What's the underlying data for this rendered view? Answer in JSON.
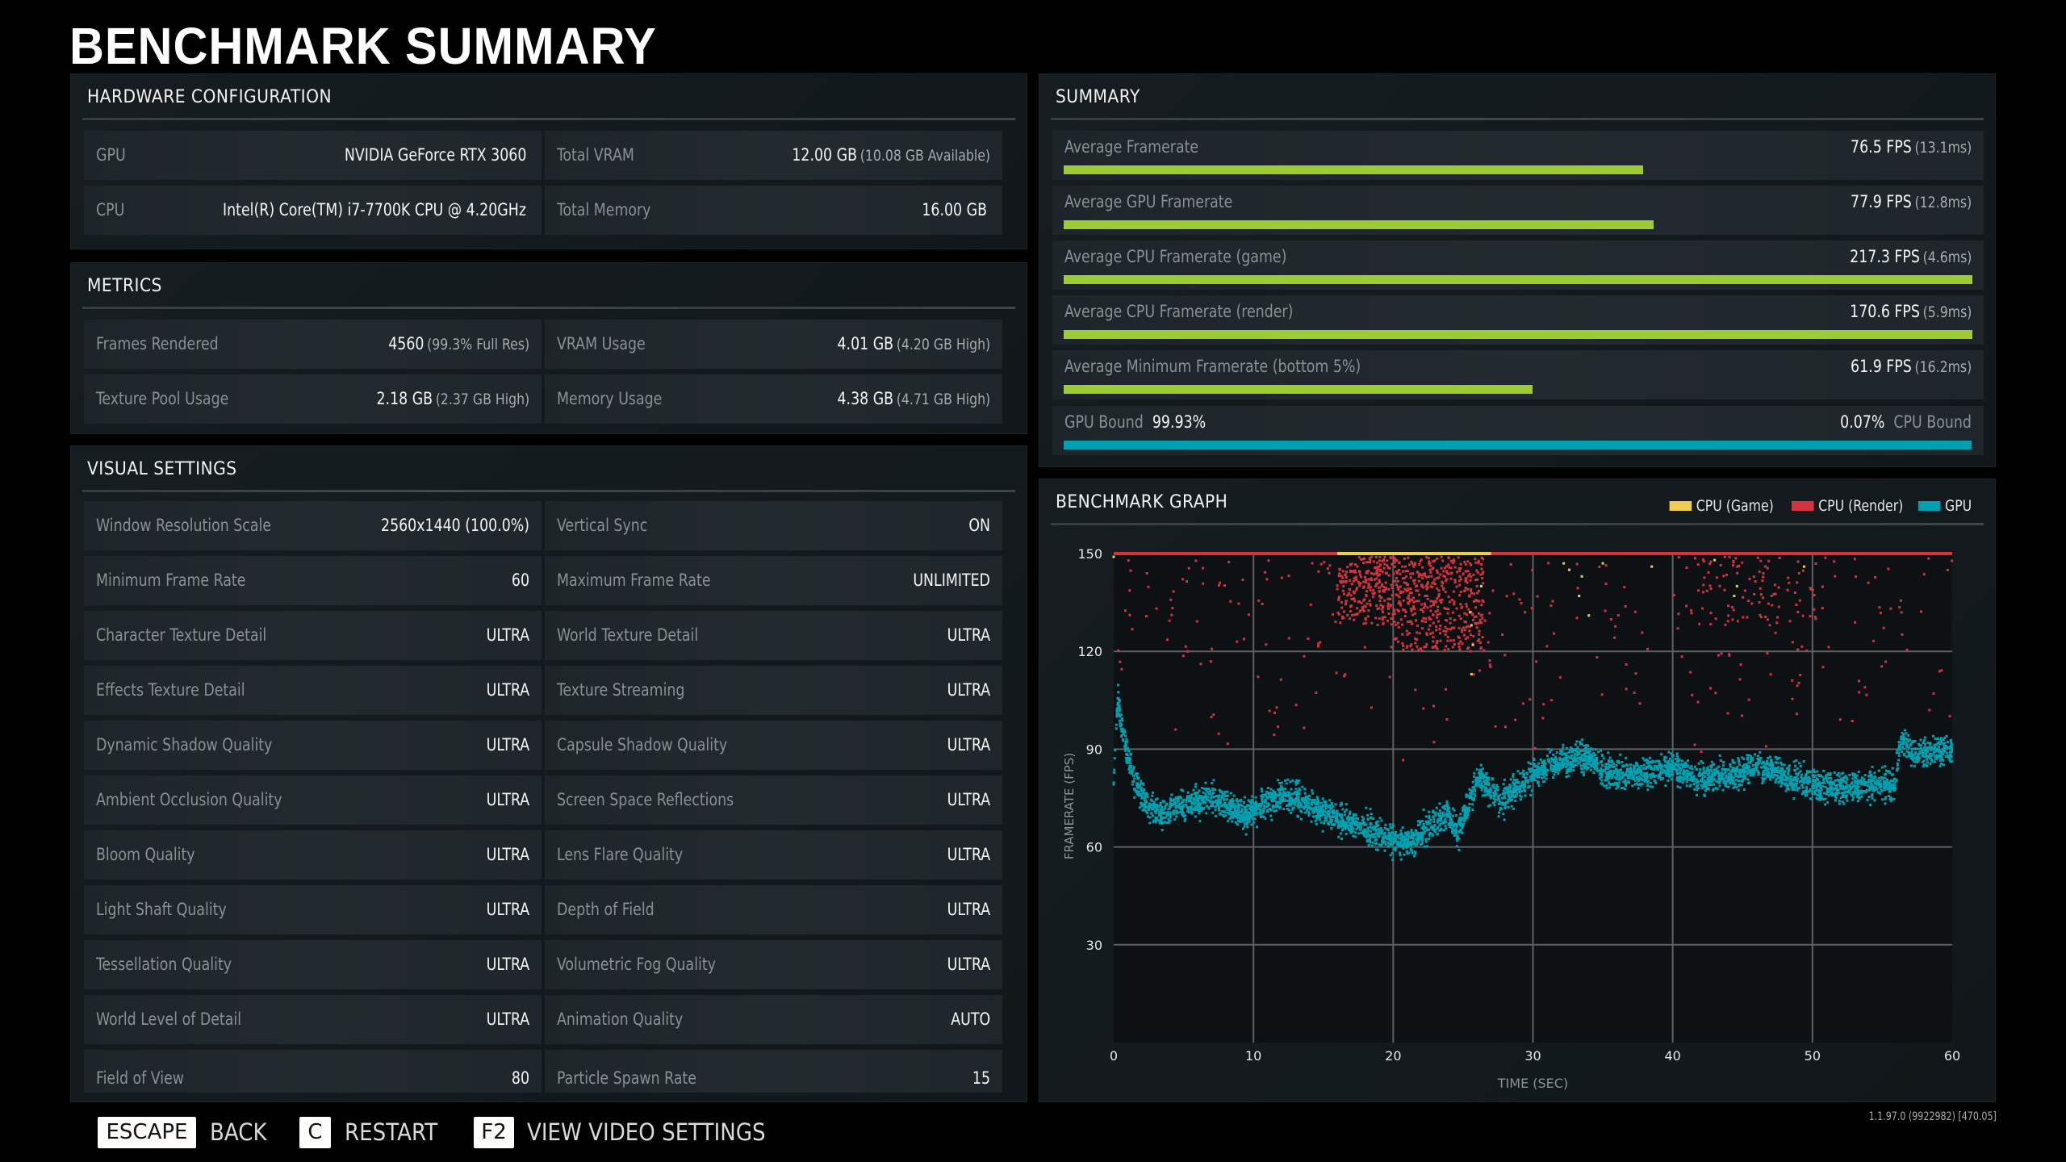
{
  "page_title": "BENCHMARK SUMMARY",
  "hardware": {
    "title": "HARDWARE CONFIGURATION",
    "rows": [
      {
        "label": "GPU",
        "value": "NVIDIA GeForce RTX 3060",
        "sub": ""
      },
      {
        "label": "Total VRAM",
        "value": "12.00 GB",
        "sub": "(10.08 GB Available)"
      },
      {
        "label": "CPU",
        "value": "Intel(R) Core(TM) i7-7700K CPU @ 4.20GHz",
        "sub": ""
      },
      {
        "label": "Total Memory",
        "value": "16.00 GB",
        "sub": ""
      }
    ]
  },
  "metrics": {
    "title": "METRICS",
    "rows": [
      {
        "label": "Frames Rendered",
        "value": "4560",
        "sub": "(99.3% Full Res)"
      },
      {
        "label": "VRAM Usage",
        "value": "4.01 GB",
        "sub": "(4.20 GB High)"
      },
      {
        "label": "Texture Pool Usage",
        "value": "2.18 GB",
        "sub": "(2.37 GB High)"
      },
      {
        "label": "Memory Usage",
        "value": "4.38 GB",
        "sub": "(4.71 GB High)"
      }
    ]
  },
  "visual_settings": {
    "title": "VISUAL SETTINGS",
    "rows": [
      {
        "label": "Window Resolution Scale",
        "value": "2560x1440 (100.0%)"
      },
      {
        "label": "Vertical Sync",
        "value": "ON"
      },
      {
        "label": "Minimum Frame Rate",
        "value": "60"
      },
      {
        "label": "Maximum Frame Rate",
        "value": "UNLIMITED"
      },
      {
        "label": "Character Texture Detail",
        "value": "ULTRA"
      },
      {
        "label": "World Texture Detail",
        "value": "ULTRA"
      },
      {
        "label": "Effects Texture Detail",
        "value": "ULTRA"
      },
      {
        "label": "Texture Streaming",
        "value": "ULTRA"
      },
      {
        "label": "Dynamic Shadow Quality",
        "value": "ULTRA"
      },
      {
        "label": "Capsule Shadow Quality",
        "value": "ULTRA"
      },
      {
        "label": "Ambient Occlusion Quality",
        "value": "ULTRA"
      },
      {
        "label": "Screen Space Reflections",
        "value": "ULTRA"
      },
      {
        "label": "Bloom Quality",
        "value": "ULTRA"
      },
      {
        "label": "Lens Flare Quality",
        "value": "ULTRA"
      },
      {
        "label": "Light Shaft Quality",
        "value": "ULTRA"
      },
      {
        "label": "Depth of Field",
        "value": "ULTRA"
      },
      {
        "label": "Tessellation Quality",
        "value": "ULTRA"
      },
      {
        "label": "Volumetric Fog Quality",
        "value": "ULTRA"
      },
      {
        "label": "World Level of Detail",
        "value": "ULTRA"
      },
      {
        "label": "Animation Quality",
        "value": "AUTO"
      },
      {
        "label": "Field of View",
        "value": "80"
      },
      {
        "label": "Particle Spawn Rate",
        "value": "15"
      }
    ]
  },
  "summary": {
    "title": "SUMMARY",
    "bar_color": "#9ccb34",
    "bound_color": "#00a0b0",
    "rows": [
      {
        "label": "Average Framerate",
        "value": "76.5 FPS",
        "sub": "(13.1ms)",
        "fill": 0.6375
      },
      {
        "label": "Average GPU Framerate",
        "value": "77.9 FPS",
        "sub": "(12.8ms)",
        "fill": 0.649
      },
      {
        "label": "Average CPU Framerate (game)",
        "value": "217.3 FPS",
        "sub": "(4.6ms)",
        "fill": 1.0
      },
      {
        "label": "Average CPU Framerate (render)",
        "value": "170.6 FPS",
        "sub": "(5.9ms)",
        "fill": 1.0
      },
      {
        "label": "Average Minimum Framerate (bottom 5%)",
        "value": "61.9 FPS",
        "sub": "(16.2ms)",
        "fill": 0.516
      }
    ],
    "bound": {
      "gpu_label": "GPU Bound",
      "gpu_value": "99.93%",
      "cpu_value": "0.07%",
      "cpu_label": "CPU Bound",
      "gpu_fraction": 0.9993
    }
  },
  "graph": {
    "title": "BENCHMARK GRAPH",
    "legend": [
      {
        "label": "CPU (Game)",
        "color": "#f0cc50"
      },
      {
        "label": "CPU (Render)",
        "color": "#d4323f"
      },
      {
        "label": "GPU",
        "color": "#00a0b0"
      }
    ]
  },
  "chart_data": {
    "type": "scatter",
    "title": "BENCHMARK GRAPH",
    "xlabel": "TIME (SEC)",
    "ylabel": "FRAMERATE (FPS)",
    "xlim": [
      0,
      60
    ],
    "ylim": [
      0,
      150
    ],
    "xticks": [
      0,
      10,
      20,
      30,
      40,
      50,
      60
    ],
    "yticks": [
      30,
      60,
      90,
      120,
      150
    ],
    "grid": true,
    "legend_position": "top-right",
    "series": [
      {
        "name": "GPU",
        "color": "#00a0b0",
        "description": "dense scatter, ~4560 frames, trend centerline (time sec, fps) with ~±5 fps spread",
        "trend": [
          [
            0,
            82
          ],
          [
            0.3,
            105
          ],
          [
            0.8,
            92
          ],
          [
            1.5,
            80
          ],
          [
            2.5,
            72
          ],
          [
            3.5,
            70
          ],
          [
            5,
            73
          ],
          [
            7,
            75
          ],
          [
            8.5,
            72
          ],
          [
            9.5,
            69
          ],
          [
            10.5,
            73
          ],
          [
            12,
            76
          ],
          [
            13.5,
            74
          ],
          [
            15,
            71
          ],
          [
            16.5,
            68
          ],
          [
            18,
            66
          ],
          [
            19.5,
            63
          ],
          [
            20.5,
            61
          ],
          [
            21.5,
            62
          ],
          [
            22.3,
            66
          ],
          [
            23.2,
            68
          ],
          [
            24,
            70
          ],
          [
            24.6,
            64
          ],
          [
            25.4,
            73
          ],
          [
            26.2,
            82
          ],
          [
            26.8,
            78
          ],
          [
            27.8,
            74
          ],
          [
            28.8,
            78
          ],
          [
            30,
            82
          ],
          [
            31.5,
            85
          ],
          [
            33,
            87
          ],
          [
            34,
            88
          ],
          [
            35,
            83
          ],
          [
            37,
            82
          ],
          [
            39,
            84
          ],
          [
            40,
            84
          ],
          [
            42,
            81
          ],
          [
            44,
            82
          ],
          [
            46,
            85
          ],
          [
            48,
            82
          ],
          [
            50,
            79
          ],
          [
            52,
            78
          ],
          [
            54,
            79
          ],
          [
            55.9,
            79
          ],
          [
            56.3,
            94
          ],
          [
            57,
            89
          ],
          [
            58.5,
            89
          ],
          [
            60,
            90
          ]
        ]
      },
      {
        "name": "CPU (Render)",
        "color": "#d4323f",
        "description": "mostly capped at 150 fps (drawn as line at top), with a dense cluster 120-150 fps between ~15-26s and sparse outliers 85-150 fps elsewhere",
        "cap": 150,
        "clusters": [
          {
            "t": [
              16,
              26.5
            ],
            "fps": [
              118,
              150
            ],
            "density": "high"
          },
          {
            "t": [
              0,
              60
            ],
            "fps": [
              85,
              150
            ],
            "density": "low"
          }
        ]
      },
      {
        "name": "CPU (Game)",
        "color": "#f0cc50",
        "description": "capped at 150 fps; visible segment on the top line between ~16-27s plus a few points 110-150 fps",
        "cap": 150,
        "cap_segment_t": [
          16,
          27
        ]
      }
    ]
  },
  "footer": {
    "keys": [
      {
        "key": "ESCAPE",
        "action": "BACK"
      },
      {
        "key": "C",
        "action": "RESTART"
      },
      {
        "key": "F2",
        "action": "VIEW VIDEO SETTINGS"
      }
    ],
    "version": "1.1.97.0 (9922982) [470.05]"
  }
}
